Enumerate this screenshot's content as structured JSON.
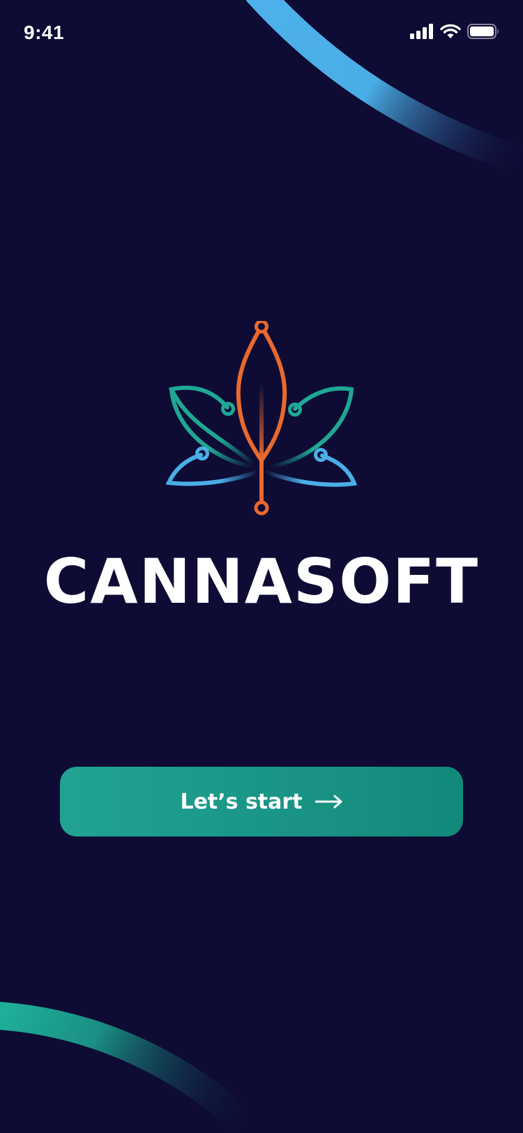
{
  "status_bar": {
    "time": "9:41",
    "icons": [
      "signal-icon",
      "wifi-icon",
      "battery-icon"
    ]
  },
  "brand": {
    "name": "CANNASOFT",
    "logo_icon": "cannabis-leaf-circuit-icon"
  },
  "start_button": {
    "label": "Let’s start",
    "icon": "arrow-right-icon"
  },
  "colors": {
    "background": "#0e0c35",
    "accent_teal": "#1ea894",
    "accent_blue": "#4aaee6",
    "accent_orange": "#e9692e",
    "text": "#ffffff"
  }
}
